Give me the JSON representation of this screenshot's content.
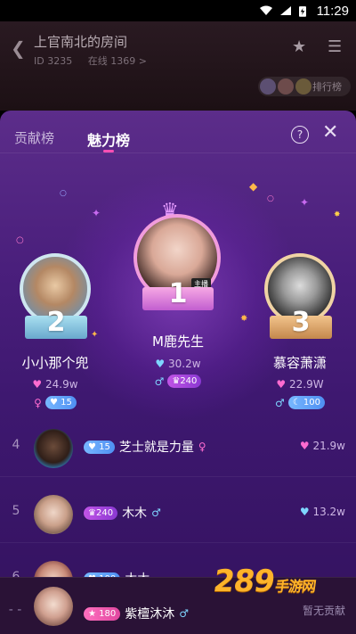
{
  "status_bar": {
    "time": "11:29"
  },
  "room": {
    "title": "上官南北的房间",
    "id_text": "ID 3235",
    "online_text": "在线 1369 >",
    "rank_button": "排行榜"
  },
  "tabs": [
    {
      "label": "贡献榜",
      "active": false
    },
    {
      "label": "魅力榜",
      "active": true
    }
  ],
  "podium": [
    {
      "rank": "1",
      "name": "M鹿先生",
      "score": "30.2w",
      "heart": "blue",
      "badge_gender": "♂",
      "badge_level": "240",
      "badge_kind": "crown",
      "tag": "主播"
    },
    {
      "rank": "2",
      "name": "小小那个兜",
      "score": "24.9w",
      "heart": "pink",
      "badge_gender": "♀",
      "badge_level": "15",
      "badge_kind": "heart"
    },
    {
      "rank": "3",
      "name": "慕容萧潇",
      "score": "22.9W",
      "heart": "pink",
      "badge_gender": "♂",
      "badge_level": "100",
      "badge_kind": "moon"
    }
  ],
  "list": [
    {
      "rank": "4",
      "name": "芝士就是力量",
      "level": "15",
      "level_kind": "heart",
      "gender": "♀",
      "score": "21.9w",
      "heart": "pink"
    },
    {
      "rank": "5",
      "name": "木木",
      "level": "240",
      "level_kind": "crown",
      "gender": "♂",
      "score": "13.2w",
      "heart": "blue"
    },
    {
      "rank": "6",
      "name": "木木",
      "level": "100",
      "level_kind": "heart",
      "gender": "",
      "score": "",
      "heart": ""
    }
  ],
  "me": {
    "rank": "- -",
    "name": "紫檀沐沐",
    "level": "180",
    "gender": "♂",
    "status": "暂无贡献"
  },
  "watermark": {
    "text": "289",
    "suffix": "手游网"
  },
  "colors": {
    "panel_top": "#5c2d8a",
    "panel_bottom": "#33125e",
    "accent_pink": "#ff4fb4",
    "heart_pink": "#ff6bd0",
    "heart_blue": "#7fd6ff"
  }
}
